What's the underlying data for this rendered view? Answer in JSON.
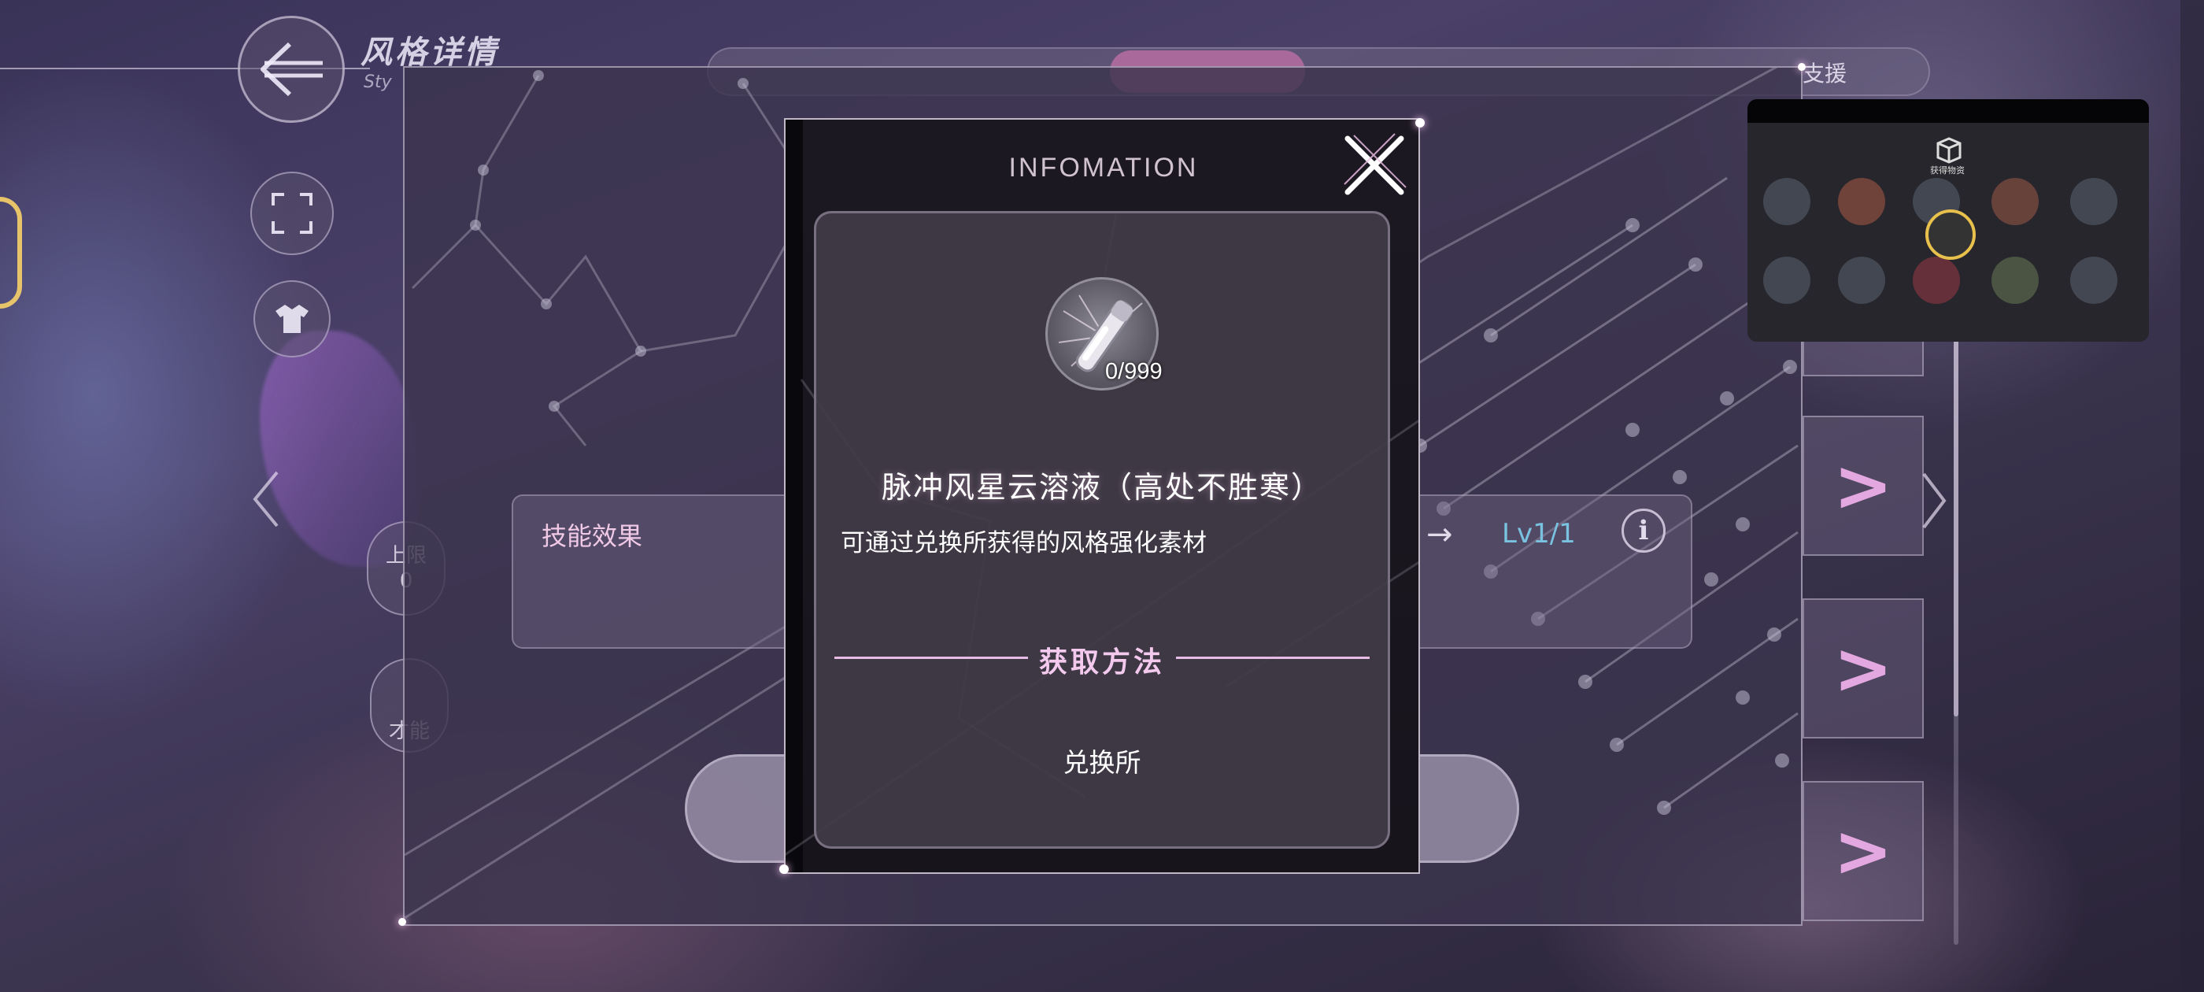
{
  "header": {
    "title": "风格详情",
    "subtitle": "Sty"
  },
  "tabs": {
    "support_label": "支援"
  },
  "left_panel": {
    "text_top": "上限",
    "text_top_sub": "0",
    "text_bottom": "才能"
  },
  "skill": {
    "label": "技能效果",
    "level": "Lv1/1",
    "arrow": "→",
    "info_glyph": "i"
  },
  "right_list": {
    "chevron": ">"
  },
  "modal": {
    "title": "INFOMATION",
    "item": {
      "count": "0/999",
      "name": "脉冲风星云溶液（高处不胜寒）",
      "description": "可通过兑换所获得的风格强化素材"
    },
    "section_title": "获取方法",
    "source": "兑换所"
  },
  "inset": {
    "label": "获得物资"
  },
  "colors": {
    "accent_pink": "#e6bce4",
    "level_blue": "#79c3e0",
    "modal_bg": "#1c1822"
  },
  "icons": [
    "back-arrow-icon",
    "fullscreen-icon",
    "outfit-icon",
    "close-icon",
    "info-icon",
    "chevron-right-icon",
    "nebula-vial-icon"
  ]
}
